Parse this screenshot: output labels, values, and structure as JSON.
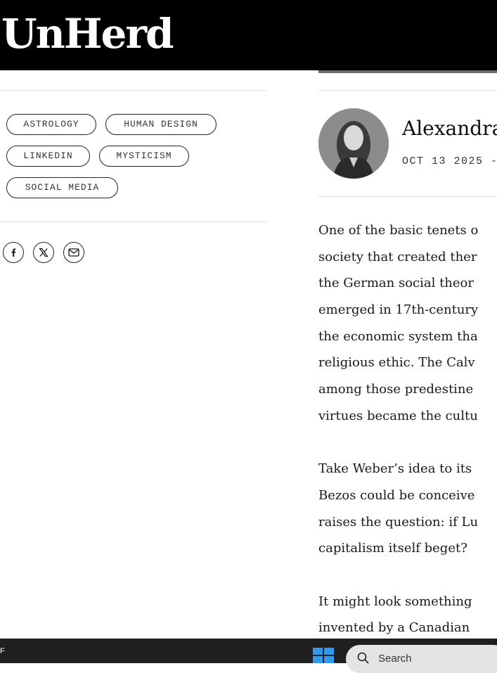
{
  "site": {
    "logo": "UnHerd"
  },
  "tags": [
    "ASTROLOGY",
    "HUMAN DESIGN",
    "LINKEDIN",
    "MYSTICISM",
    "SOCIAL MEDIA"
  ],
  "share_icons": [
    "facebook-icon",
    "x-icon",
    "email-icon"
  ],
  "author": {
    "name": "Alexandra",
    "date_line": "OCT 13 2025 -"
  },
  "article": {
    "lines": [
      "One of the basic tenets o",
      "society that created ther",
      "the German social theor",
      "emerged in 17th-century",
      "the economic system tha",
      "religious ethic.  The Calv",
      "among those predestine",
      "virtues became the cultu",
      "",
      "Take Weber’s idea to its",
      "Bezos could be conceive",
      "raises the question: if Lu",
      "capitalism itself beget?",
      "",
      "It might look something",
      "invented by a Canadian"
    ]
  },
  "taskbar": {
    "left_text": "F",
    "search_placeholder": "Search"
  },
  "colors": {
    "masthead": "#000000",
    "taskbar": "#1f1f1f",
    "windows_blue": "#2f9bf0"
  }
}
